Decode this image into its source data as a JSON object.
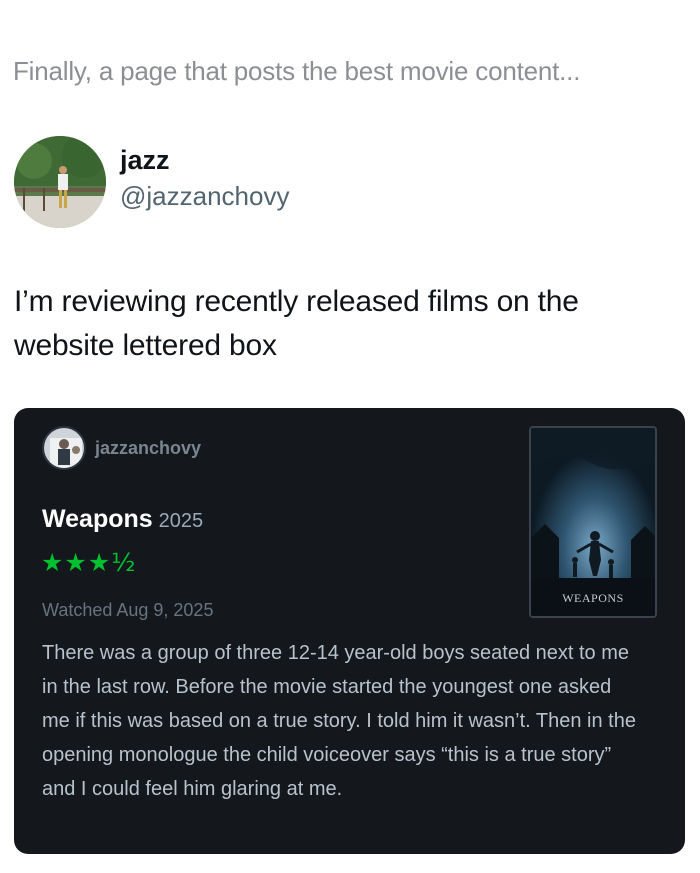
{
  "caption": "Finally, a page that posts the best movie content...",
  "author": {
    "display_name": "jazz",
    "handle": "@jazzanchovy"
  },
  "tweet_text": "I’m reviewing recently released films on the website lettered box",
  "review_card": {
    "username": "jazzanchovy",
    "film_title": "Weapons",
    "film_year": "2025",
    "rating": 3.5,
    "rating_display": "★★★½",
    "watched": "Watched Aug 9, 2025",
    "review_text": "There was a group of three 12-14 year-old boys seated next to me in the last row. Before the movie started the youngest one asked me if this was based on a true story. I told him it wasn’t. Then in the opening monologue the child voiceover says “this is a true story” and I could feel him glaring at me.",
    "poster_label": "WEAPONS"
  },
  "colors": {
    "card_background": "#14181c",
    "star_green": "#00c030",
    "caption_gray": "#8b8f94",
    "handle_gray": "#536471"
  }
}
